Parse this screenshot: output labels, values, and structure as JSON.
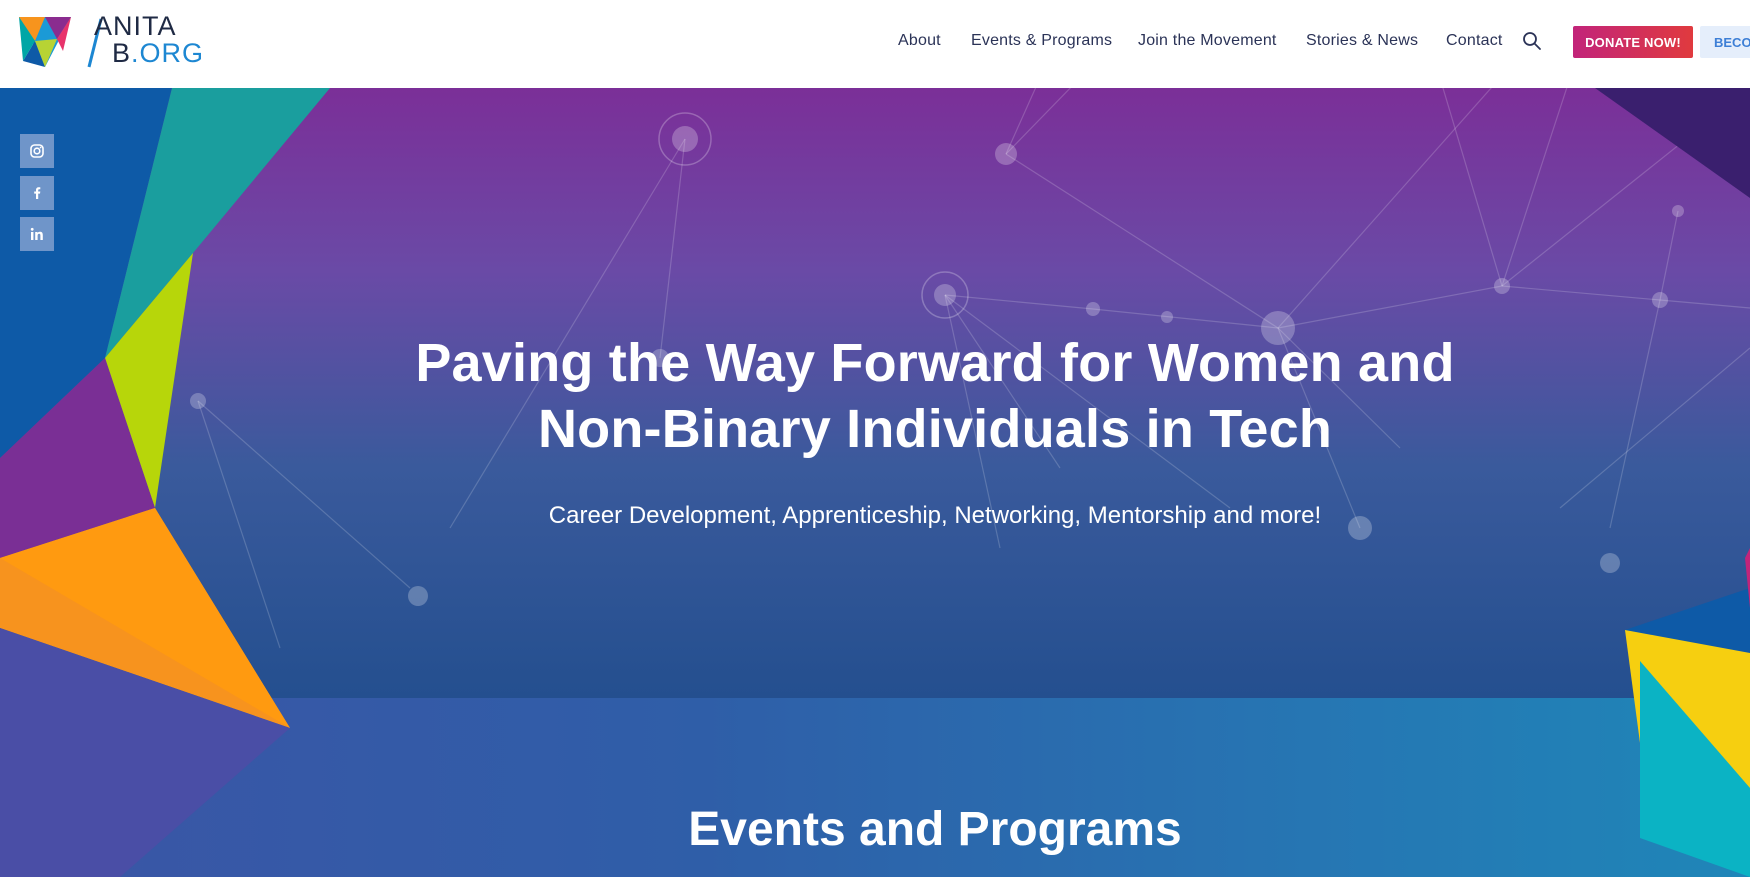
{
  "header": {
    "logo": {
      "line1": "ANITA",
      "line2_b": "B",
      "line2_org": ".ORG"
    },
    "nav": [
      {
        "label": "About"
      },
      {
        "label": "Events & Programs"
      },
      {
        "label": "Join the Movement"
      },
      {
        "label": "Stories & News"
      },
      {
        "label": "Contact"
      }
    ],
    "search_icon": "search-icon",
    "donate_label": "DONATE NOW!",
    "become_label": "BECOM"
  },
  "social": [
    {
      "icon": "instagram-icon"
    },
    {
      "icon": "facebook-icon"
    },
    {
      "icon": "linkedin-icon"
    }
  ],
  "hero": {
    "title_line1": "Paving the Way Forward for Women and",
    "title_line2": "Non-Binary Individuals in Tech",
    "subtitle": "Career Development, Apprenticeship, Networking, Mentorship and more!"
  },
  "events": {
    "title": "Events and Programs"
  },
  "colors": {
    "nav_text": "#2b3357",
    "donate_from": "#c2247a",
    "donate_to": "#e03a3e",
    "become_bg": "#e5eefb",
    "become_text": "#3d7fd6",
    "logo_org": "#1d87d2"
  }
}
